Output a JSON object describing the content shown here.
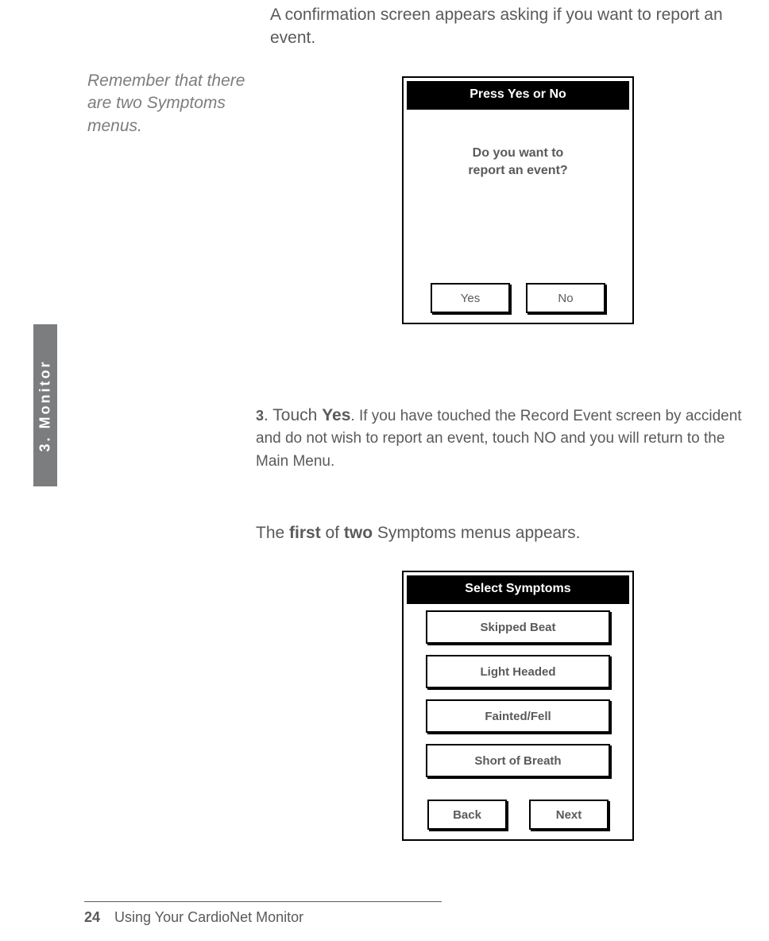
{
  "intro": "A confirmation screen appears asking if you want to report an event.",
  "margin_note": "Remember that there are two Symptoms menus.",
  "side_tab": "3.  Monitor",
  "screen1": {
    "title": "Press Yes or No",
    "prompt_line1": "Do you want to",
    "prompt_line2": "report an event?",
    "yes": "Yes",
    "no": "No"
  },
  "step3": {
    "num": "3",
    "lead": ". Touch ",
    "yes": "Yes",
    "after": ". If you have touched the Record Event screen by accident and do not wish to report an event, touch NO and you will return to the Main Menu."
  },
  "para2": {
    "pre": "The ",
    "first": "first",
    "mid": " of ",
    "two": "two",
    "post": " Symptoms menus appears."
  },
  "screen2": {
    "title": "Select Symptoms",
    "items": [
      "Skipped Beat",
      "Light Headed",
      "Fainted/Fell",
      "Short of Breath"
    ],
    "back": "Back",
    "next": "Next"
  },
  "footer": {
    "page": "24",
    "title": "Using Your CardioNet Monitor"
  }
}
